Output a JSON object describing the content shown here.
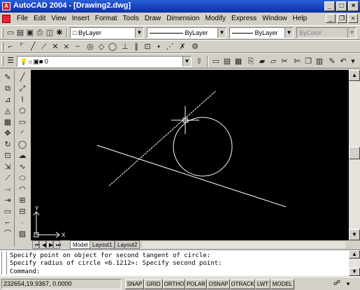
{
  "window": {
    "app_icon_label": "A",
    "title": "AutoCAD 2004 - [Drawing2.dwg]",
    "minimize": "_",
    "maximize": "□",
    "close": "×"
  },
  "menu": {
    "items": [
      "File",
      "Edit",
      "View",
      "Insert",
      "Format",
      "Tools",
      "Draw",
      "Dimension",
      "Modify",
      "Express",
      "Window",
      "Help"
    ],
    "doc_minimize": "_",
    "doc_restore": "❐",
    "doc_close": "×"
  },
  "properties": {
    "layer_combo": "ByLayer",
    "linetype_combo": "ByLayer",
    "lineweight_combo": "ByLayer",
    "color_combo": "ByColor"
  },
  "layers": {
    "current_layer": "0"
  },
  "tabs": [
    "Model",
    "Layout1",
    "Layout2"
  ],
  "command": {
    "lines": [
      "Specify point on object for second tangent of circle:",
      "Specify radius of circle <6.1212>:  Specify second point:",
      "Command:"
    ]
  },
  "status": {
    "coords": "232654,19.9367, 0.0000",
    "buttons": [
      "SNAP",
      "GRID",
      "ORTHO",
      "POLAR",
      "OSNAP",
      "OTRACK",
      "LWT",
      "MODEL"
    ]
  },
  "ucs": {
    "x_label": "X",
    "y_label": "Y"
  },
  "colors": {
    "title_bar": "#0a2fa8",
    "canvas_bg": "#000000",
    "drawing_lines": "#ffffff"
  }
}
